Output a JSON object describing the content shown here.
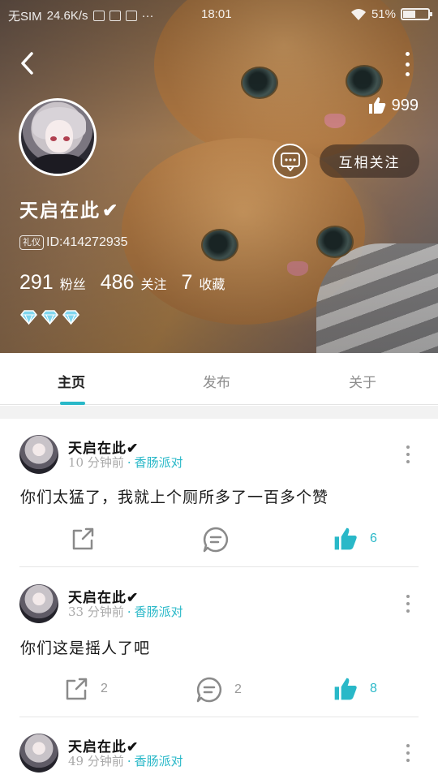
{
  "status_bar": {
    "carrier": "无SIM",
    "net_speed": "24.6K/s",
    "time": "18:01",
    "battery": "51%"
  },
  "profile": {
    "like_count": "999",
    "follow_button": "互相关注",
    "username": "天启在此",
    "verified_mark": "✔",
    "badge": "礼仪",
    "id_text": "ID:414272935",
    "stats": [
      {
        "number": "291",
        "label": "粉丝"
      },
      {
        "number": "486",
        "label": "关注"
      },
      {
        "number": "7",
        "label": "收藏"
      }
    ],
    "gem_count": 3
  },
  "tabs": [
    {
      "label": "主页",
      "active": true
    },
    {
      "label": "发布",
      "active": false
    },
    {
      "label": "关于",
      "active": false
    }
  ],
  "posts": [
    {
      "author": "天启在此✔",
      "time": "10 分钟前",
      "dot": "·",
      "topic": "香肠派对",
      "text": "你们太猛了，我就上个厕所多了一百多个赞",
      "share_count": "",
      "comment_count": "",
      "like_count": "6"
    },
    {
      "author": "天启在此✔",
      "time": "33 分钟前",
      "dot": "·",
      "topic": "香肠派对",
      "text": "你们这是摇人了吧",
      "share_count": "2",
      "comment_count": "2",
      "like_count": "8"
    },
    {
      "author": "天启在此✔",
      "time": "49 分钟前",
      "dot": "·",
      "topic": "香肠派对",
      "text": "",
      "share_count": "",
      "comment_count": "",
      "like_count": ""
    }
  ],
  "colors": {
    "accent": "#29b8c8",
    "tab_active_text": "#222222",
    "tab_inactive_text": "#8c8c8c",
    "meta_text": "#aaaaaa"
  },
  "icons": {
    "back": "chevron-left-icon",
    "more": "more-vertical-icon",
    "thumb": "thumb-up-icon",
    "message": "message-icon",
    "share": "share-icon",
    "comment": "comment-icon",
    "gem": "diamond-icon"
  }
}
